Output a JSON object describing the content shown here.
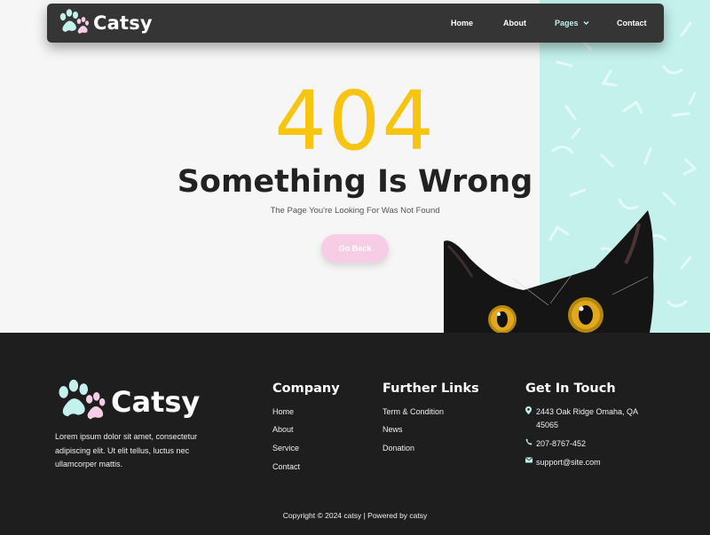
{
  "brand": {
    "name": "Catsy"
  },
  "nav": {
    "home": "Home",
    "about": "About",
    "pages": "Pages",
    "contact": "Contact"
  },
  "error": {
    "code": "404",
    "headline": "Something Is Wrong",
    "subtext": "The Page You're Looking For Was Not Found",
    "button": "Go Back"
  },
  "footer": {
    "brand_name": "Catsy",
    "description": "Lorem ipsum dolor sit amet, consectetur adipiscing elit. Ut elit tellus, luctus nec ullamcorper mattis.",
    "company": {
      "title": "Company",
      "links": [
        "Home",
        "About",
        "Service",
        "Contact"
      ]
    },
    "further": {
      "title": "Further Links",
      "links": [
        "Term & Condition",
        "News",
        "Donation"
      ]
    },
    "touch": {
      "title": "Get In Touch",
      "address": "2443 Oak Ridge Omaha, QA 45065",
      "phone": "207-8767-452",
      "email": "support@site.com"
    },
    "copyright": "Copyright © 2024 catsy | Powered by catsy"
  },
  "colors": {
    "accent_yellow": "#f7c40f",
    "paw_mint": "#c4f1ec",
    "paw_pink": "#f7cde6",
    "navbar": "#353535",
    "footer": "#1e1e1f"
  }
}
